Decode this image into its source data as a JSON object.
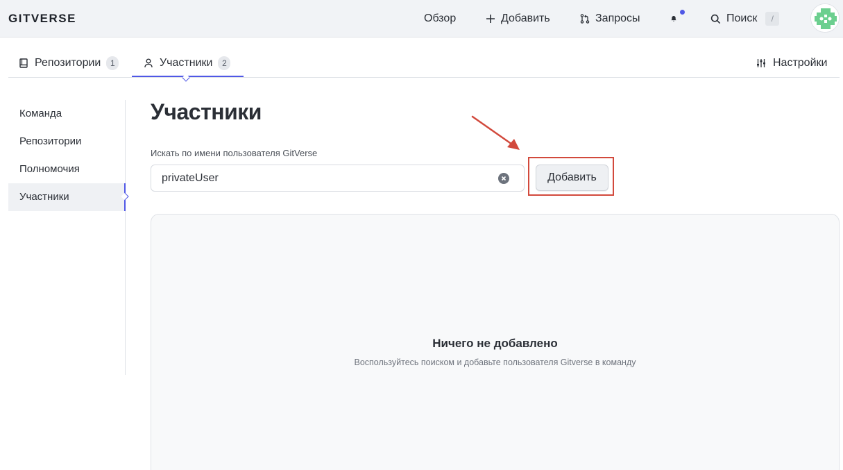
{
  "brand": {
    "logo_text": "GITVERSE"
  },
  "topnav": {
    "overview": "Обзор",
    "add": "Добавить",
    "requests": "Запросы",
    "search": "Поиск",
    "search_shortcut": "/"
  },
  "tabs": {
    "repositories": {
      "label": "Репозитории",
      "count": "1"
    },
    "members": {
      "label": "Участники",
      "count": "2"
    },
    "settings": "Настройки"
  },
  "sidebar": {
    "items": [
      {
        "label": "Команда"
      },
      {
        "label": "Репозитории"
      },
      {
        "label": "Полномочия"
      },
      {
        "label": "Участники"
      }
    ],
    "active_index": 3
  },
  "main": {
    "title": "Участники",
    "search_label": "Искать по имени пользователя GitVerse",
    "search_value": "privateUser",
    "add_button": "Добавить",
    "empty_title": "Ничего не добавлено",
    "empty_subtitle": "Воспользуйтесь поиском и добавьте пользователя Gitverse в команду"
  },
  "colors": {
    "accent": "#5058e6",
    "highlight": "#d2493c",
    "topbar_bg": "#f1f3f6"
  },
  "icons": [
    "plus-icon",
    "pull-request-icon",
    "bell-icon",
    "search-icon",
    "repository-icon",
    "user-icon",
    "settings-sliders-icon",
    "clear-icon"
  ]
}
